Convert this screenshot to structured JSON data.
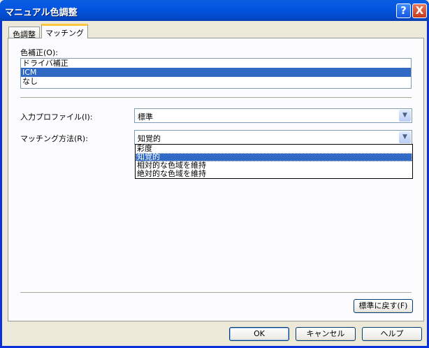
{
  "window": {
    "title": "マニュアル色調整",
    "help_icon": "?",
    "close_icon": "X"
  },
  "tabs": [
    {
      "label": "色調整"
    },
    {
      "label": "マッチング",
      "active": true
    }
  ],
  "color_correction": {
    "label": "色補正(O):",
    "items": [
      "ドライバ補正",
      "ICM",
      "なし"
    ],
    "selected": "ICM"
  },
  "input_profile": {
    "label": "入力プロファイル(I):",
    "value": "標準"
  },
  "matching_method": {
    "label": "マッチング方法(R):",
    "value": "知覚的",
    "options": [
      "彩度",
      "知覚的",
      "相対的な色域を維持",
      "絶対的な色域を維持"
    ],
    "highlighted": "知覚的"
  },
  "buttons": {
    "reset": "標準に戻す(F)",
    "ok": "OK",
    "cancel": "キャンセル",
    "help": "ヘルプ"
  },
  "colors": {
    "selection": "#316ac5",
    "titlebar": "#0355e0"
  }
}
